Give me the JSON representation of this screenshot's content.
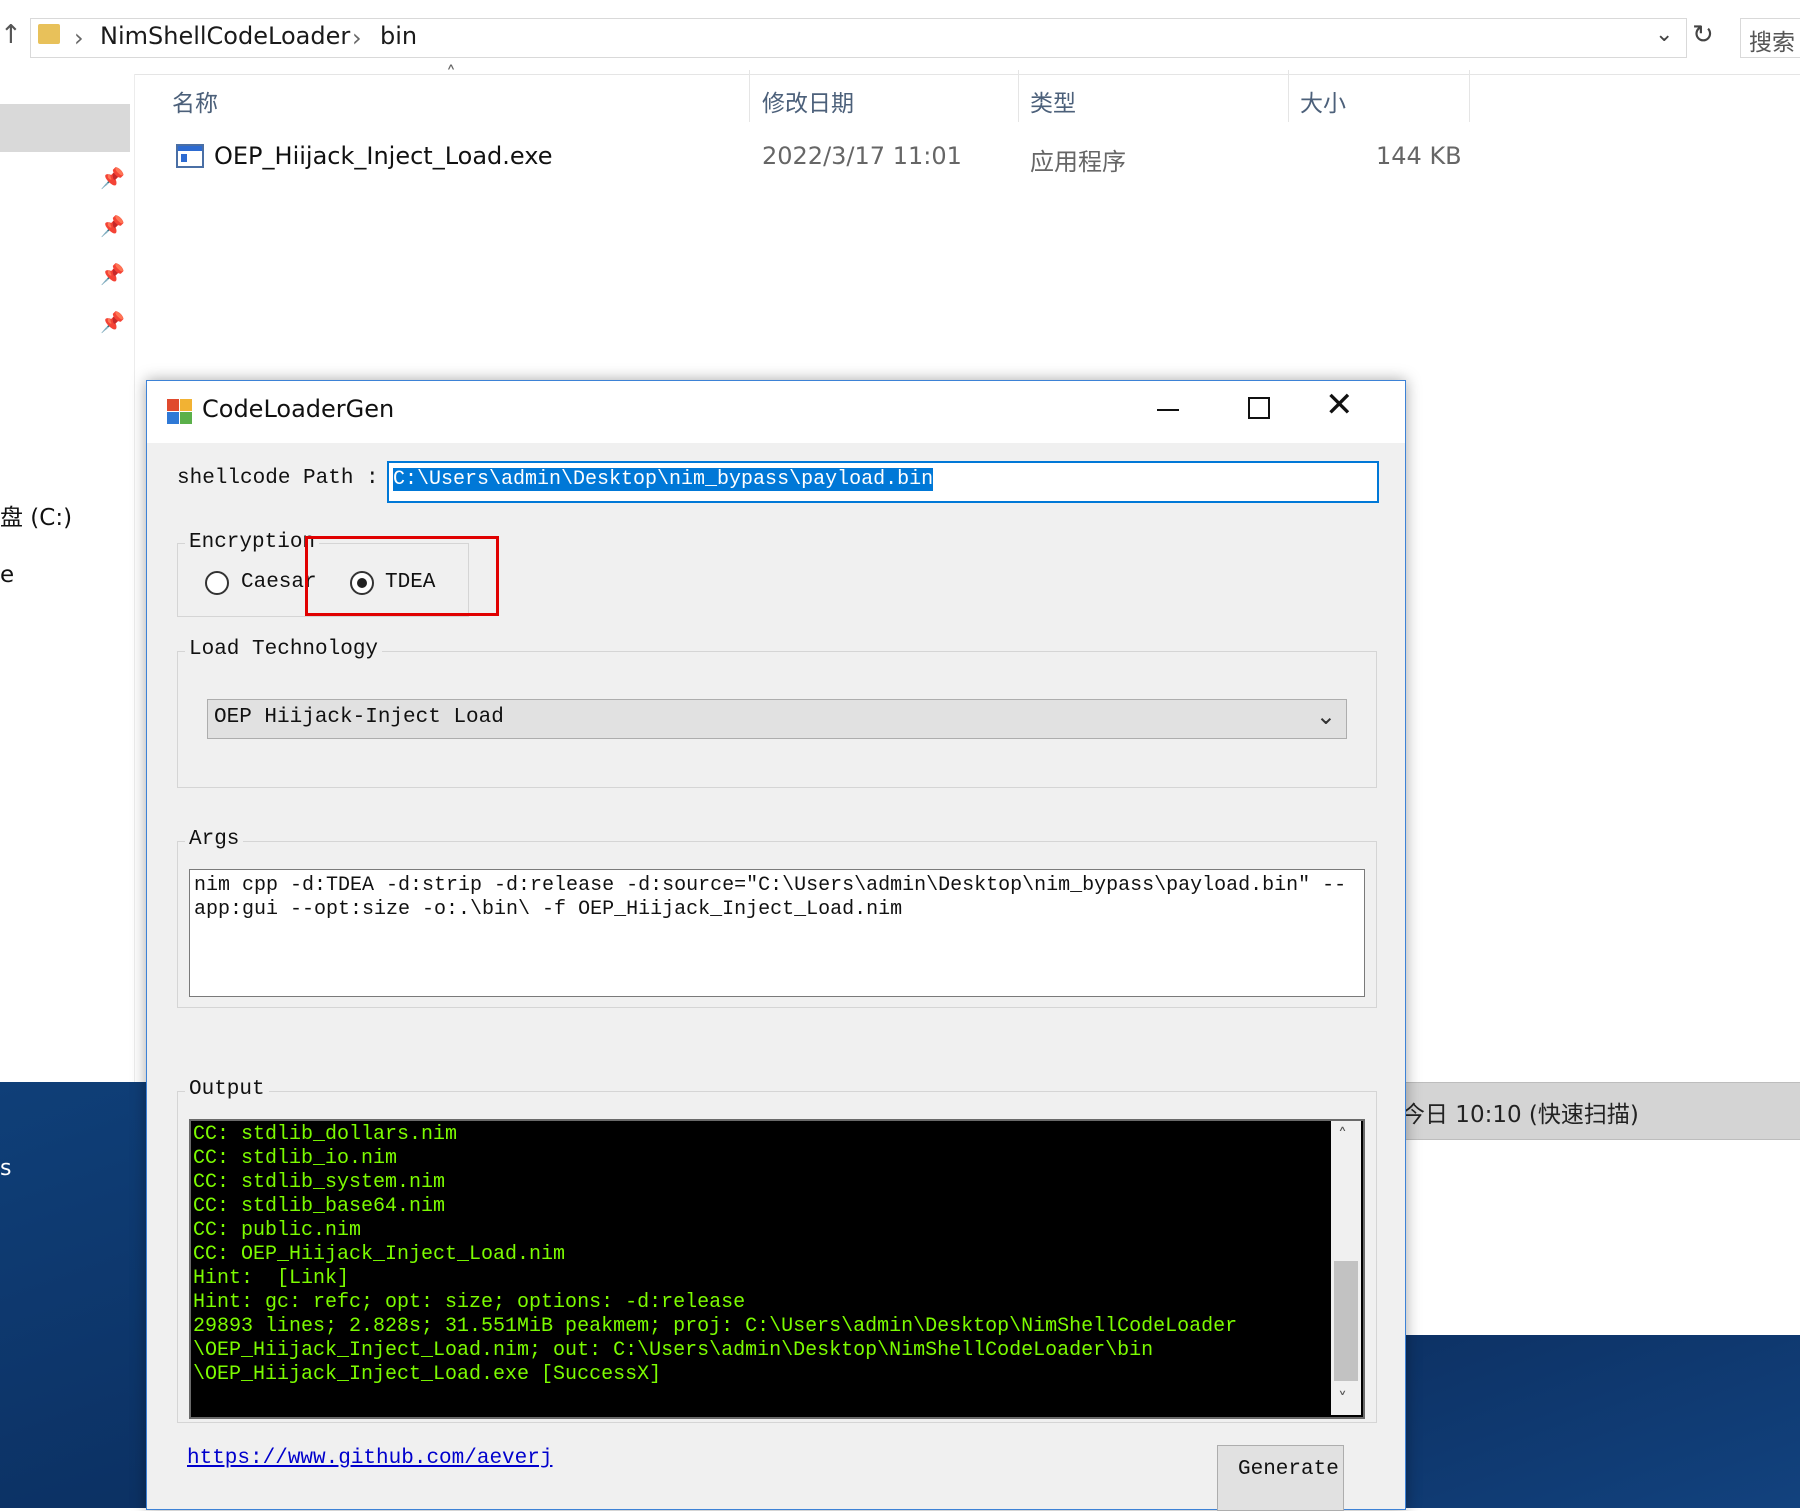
{
  "explorer": {
    "breadcrumb": [
      "NimShellCodeLoader",
      "bin"
    ],
    "search_placeholder": "搜索",
    "columns": {
      "name": "名称",
      "modified": "修改日期",
      "type": "类型",
      "size": "大小"
    },
    "files": [
      {
        "name": "OEP_Hiijack_Inject_Load.exe",
        "modified": "2022/3/17 11:01",
        "type": "应用程序",
        "size": "144 KB"
      }
    ],
    "nav": {
      "drive": "盘 (C:)",
      "partial_e": "e",
      "partial_s": "s"
    },
    "status_strip": "今日 10:10 (快速扫描)"
  },
  "dialog": {
    "title": "CodeLoaderGen",
    "shellcode_label": "shellcode Path :",
    "shellcode_value": "C:\\Users\\admin\\Desktop\\nim_bypass\\payload.bin",
    "encryption_label": "Encryption",
    "radio_caesar": "Caesar",
    "radio_tdea": "TDEA",
    "selected_encryption": "TDEA",
    "load_label": "Load Technology",
    "load_value": "OEP Hiijack-Inject Load",
    "args_label": "Args",
    "args_value": "nim cpp -d:TDEA -d:strip -d:release -d:source=\"C:\\Users\\admin\\Desktop\\nim_bypass\\payload.bin\" --app:gui --opt:size -o:.\\bin\\ -f OEP_Hiijack_Inject_Load.nim",
    "output_label": "Output",
    "output_lines": [
      "CC: stdlib_dollars.nim",
      "CC: stdlib_io.nim",
      "CC: stdlib_system.nim",
      "CC: stdlib_base64.nim",
      "CC: public.nim",
      "CC: OEP_Hiijack_Inject_Load.nim",
      "Hint:  [Link]",
      "Hint: gc: refc; opt: size; options: -d:release",
      "29893 lines; 2.828s; 31.551MiB peakmem; proj: C:\\Users\\admin\\Desktop\\NimShellCodeLoader",
      "\\OEP_Hiijack_Inject_Load.nim; out: C:\\Users\\admin\\Desktop\\NimShellCodeLoader\\bin",
      "\\OEP_Hiijack_Inject_Load.exe [SuccessX]"
    ],
    "link": "https://www.github.com/aeverj",
    "generate_button": "Generate"
  },
  "colors": {
    "accent": "#0078d7",
    "highlight_box": "#e00000",
    "console_text": "#7cfc00"
  }
}
